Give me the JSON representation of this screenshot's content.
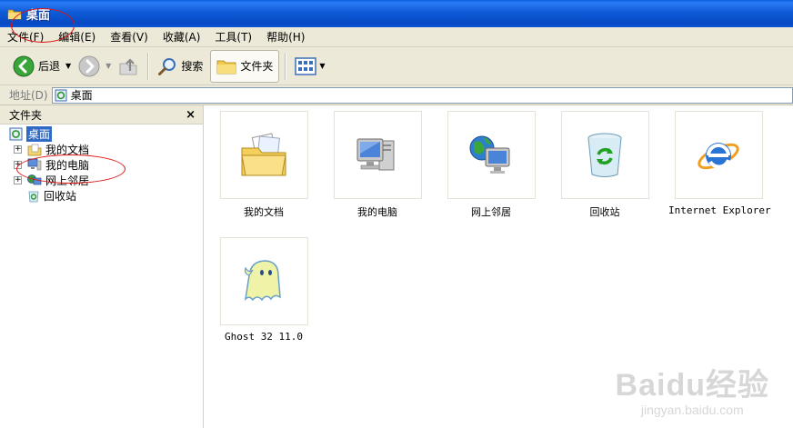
{
  "window": {
    "title": "桌面"
  },
  "menu": [
    "文件(F)",
    "编辑(E)",
    "查看(V)",
    "收藏(A)",
    "工具(T)",
    "帮助(H)"
  ],
  "toolbar": {
    "back_label": "后退",
    "search_label": "搜索",
    "folders_label": "文件夹"
  },
  "address": {
    "label": "地址(D)",
    "value": "桌面"
  },
  "folders_panel": {
    "title": "文件夹",
    "close_glyph": "×",
    "tree": [
      {
        "label": "桌面",
        "selected": true,
        "expander": ""
      },
      {
        "label": "我的文档",
        "expander": "+"
      },
      {
        "label": "我的电脑",
        "expander": "+"
      },
      {
        "label": "网上邻居",
        "expander": "+"
      },
      {
        "label": "回收站",
        "expander": ""
      }
    ]
  },
  "items": [
    {
      "label": "我的文档",
      "icon": "my-documents-icon"
    },
    {
      "label": "我的电脑",
      "icon": "my-computer-icon"
    },
    {
      "label": "网上邻居",
      "icon": "network-places-icon"
    },
    {
      "label": "回收站",
      "icon": "recycle-bin-icon"
    },
    {
      "label": "Internet Explorer",
      "icon": "internet-explorer-icon"
    },
    {
      "label": "Ghost 32 11.0",
      "icon": "ghost-icon"
    }
  ],
  "watermark": {
    "line1": "Baidu经验",
    "line2": "jingyan.baidu.com"
  },
  "colors": {
    "title_blue": "#0a55d6",
    "selection": "#316ac5",
    "chrome": "#ece9d8",
    "annotation_red": "#dd1111"
  }
}
